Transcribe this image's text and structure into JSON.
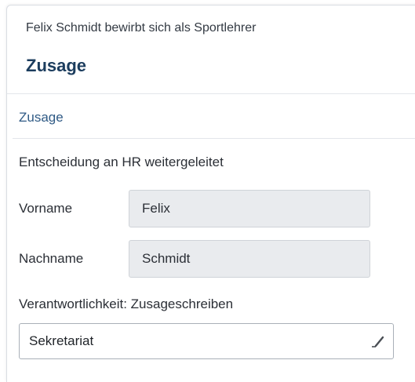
{
  "header": {
    "subtitle": "Felix Schmidt bewirbt sich als Sportlehrer",
    "title": "Zusage"
  },
  "section": {
    "title": "Zusage",
    "status_text": "Entscheidung an HR weitergeleitet"
  },
  "fields": {
    "first_name": {
      "label": "Vorname",
      "value": "Felix"
    },
    "last_name": {
      "label": "Nachname",
      "value": "Schmidt"
    }
  },
  "responsibility": {
    "label": "Verantwortlichkeit: Zusageschreiben",
    "value": "Sekretariat",
    "icon": "edit-pencil-icon"
  },
  "colors": {
    "title": "#1c3d5e",
    "section_title": "#2f5a85",
    "readonly_field_bg": "#e9ebee"
  }
}
